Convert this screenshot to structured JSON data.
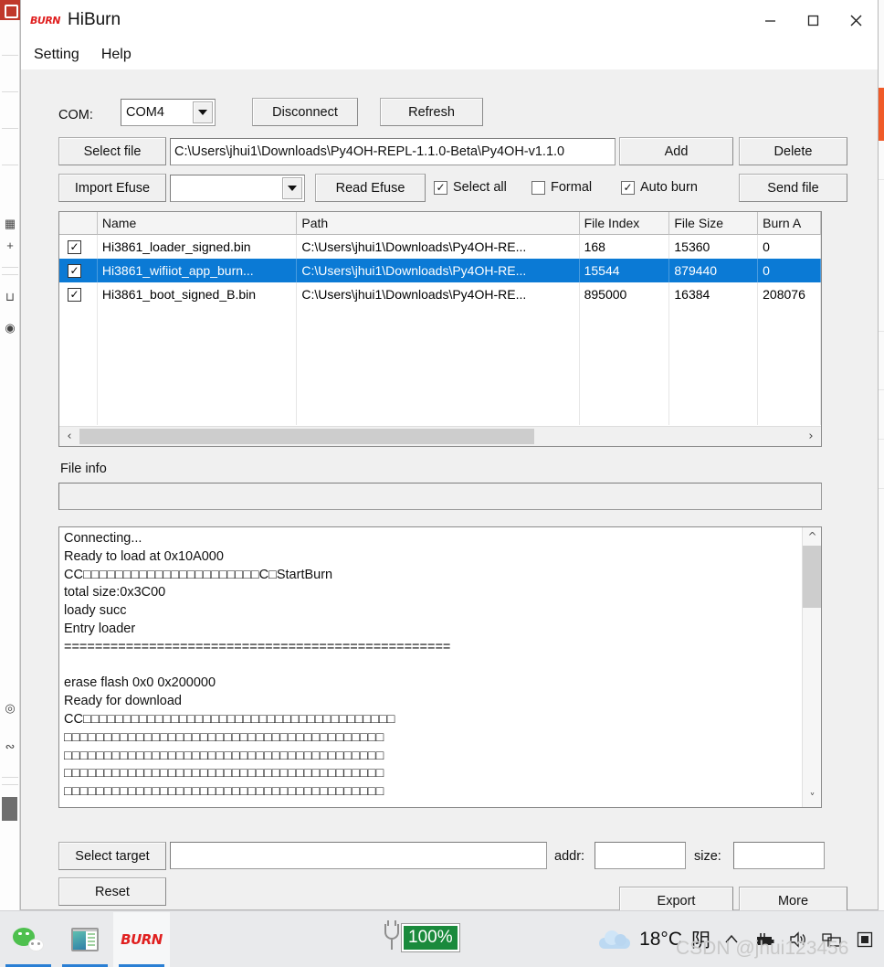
{
  "window": {
    "title": "HiBurn",
    "logo_text": "BURN",
    "minimize_label": "Minimize",
    "maximize_label": "Maximize",
    "close_label": "Close"
  },
  "menu": {
    "items": [
      {
        "label": "Setting"
      },
      {
        "label": "Help"
      }
    ]
  },
  "toolbar": {
    "com_label": "COM:",
    "com_value": "COM4",
    "disconnect_label": "Disconnect",
    "refresh_label": "Refresh",
    "select_file_label": "Select file",
    "file_path_value": "C:\\Users\\jhui1\\Downloads\\Py4OH-REPL-1.1.0-Beta\\Py4OH-v1.1.0",
    "add_label": "Add",
    "delete_label": "Delete",
    "import_efuse_label": "Import Efuse",
    "efuse_combo_value": "",
    "read_efuse_label": "Read Efuse",
    "select_all_label": "Select all",
    "select_all_checked": true,
    "formal_label": "Formal",
    "formal_checked": false,
    "auto_burn_label": "Auto burn",
    "auto_burn_checked": true,
    "send_file_label": "Send file"
  },
  "table": {
    "columns": [
      "",
      "Name",
      "Path",
      "File Index",
      "File Size",
      "Burn A"
    ],
    "rows": [
      {
        "checked": true,
        "name": "Hi3861_loader_signed.bin",
        "path": "C:\\Users\\jhui1\\Downloads\\Py4OH-RE...",
        "file_index": "168",
        "file_size": "15360",
        "burn_addr": "0",
        "selected": false
      },
      {
        "checked": true,
        "name": "Hi3861_wifiiot_app_burn...",
        "path": "C:\\Users\\jhui1\\Downloads\\Py4OH-RE...",
        "file_index": "15544",
        "file_size": "879440",
        "burn_addr": "0",
        "selected": true
      },
      {
        "checked": true,
        "name": "Hi3861_boot_signed_B.bin",
        "path": "C:\\Users\\jhui1\\Downloads\\Py4OH-RE...",
        "file_index": "895000",
        "file_size": "16384",
        "burn_addr": "208076",
        "selected": false
      }
    ]
  },
  "file_info": {
    "label": "File info",
    "value": ""
  },
  "console": {
    "text": "Connecting...\nReady to load at 0x10A000\nCC□□□□□□□□□□□□□□□□□□□□□□C□StartBurn\ntotal size:0x3C00\nloady succ\nEntry loader\n==================================================\n\nerase flash 0x0 0x200000\nReady for download\nCC□□□□□□□□□□□□□□□□□□□□□□□□□□□□□□□□□□□□□□□\n□□□□□□□□□□□□□□□□□□□□□□□□□□□□□□□□□□□□□□□□\n□□□□□□□□□□□□□□□□□□□□□□□□□□□□□□□□□□□□□□□□\n□□□□□□□□□□□□□□□□□□□□□□□□□□□□□□□□□□□□□□□□\n□□□□□□□□□□□□□□□□□□□□□□□□□□□□□□□□□□□□□□□□"
  },
  "bottom": {
    "select_target_label": "Select target",
    "target_value": "",
    "reset_label": "Reset",
    "addr_label": "addr:",
    "addr_value": "",
    "size_label": "size:",
    "size_value": "",
    "export_label": "Export",
    "more_label": "More"
  },
  "taskbar": {
    "items": [
      {
        "icon": "wechat-icon",
        "active": false
      },
      {
        "icon": "window-preview-icon",
        "active": false
      },
      {
        "icon": "hiburn-icon",
        "label": "BURN",
        "active": true
      }
    ],
    "battery_percent": "100%",
    "temperature": "18°C",
    "weather_text": "阴",
    "watermark": "CSDN @jhui123456"
  },
  "colors": {
    "selection_blue": "#0b7ad5",
    "accent_red": "#e02020",
    "battery_green": "#1a8a3c",
    "taskbar_underline": "#2a7fd4"
  }
}
